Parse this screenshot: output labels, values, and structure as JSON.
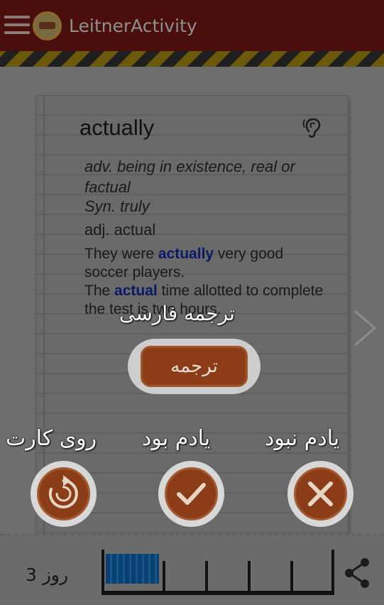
{
  "app": {
    "title": "LeitnerActivity",
    "menu_icon": "hamburger-menu-icon",
    "logo_icon": "essential-toefl-logo"
  },
  "card": {
    "word": "actually",
    "definition": "adv. being in existence, real or factual",
    "synonym": "Syn. truly",
    "adjective": "adj. actual",
    "example1_before": "They were ",
    "example1_highlight": "actually",
    "example1_after": " very good soccer players.",
    "example2_before": "The ",
    "example2_highlight": "actual",
    "example2_after": " time allotted  to complete the test is two hours.",
    "pronounce_icon": "ear-icon",
    "next_icon": "chevron-right-icon"
  },
  "hints": {
    "translate": "ترجمه فارسی",
    "back_of_card": "روی کارت",
    "known": "یادم بود",
    "unknown": "یادم نبود"
  },
  "buttons": {
    "translate_label": "ترجمه",
    "flip_icon": "refresh-icon",
    "known_icon": "check-icon",
    "unknown_icon": "close-icon"
  },
  "footer": {
    "day_label": "روز 3",
    "progress_filled_compartments": 1,
    "compartments": 5,
    "share_icon": "share-icon"
  },
  "colors": {
    "appbar": "#4a0e0c",
    "button": "#8b3d17",
    "highlight": "#0c1a66",
    "progress_fill": "#0a3f70"
  }
}
